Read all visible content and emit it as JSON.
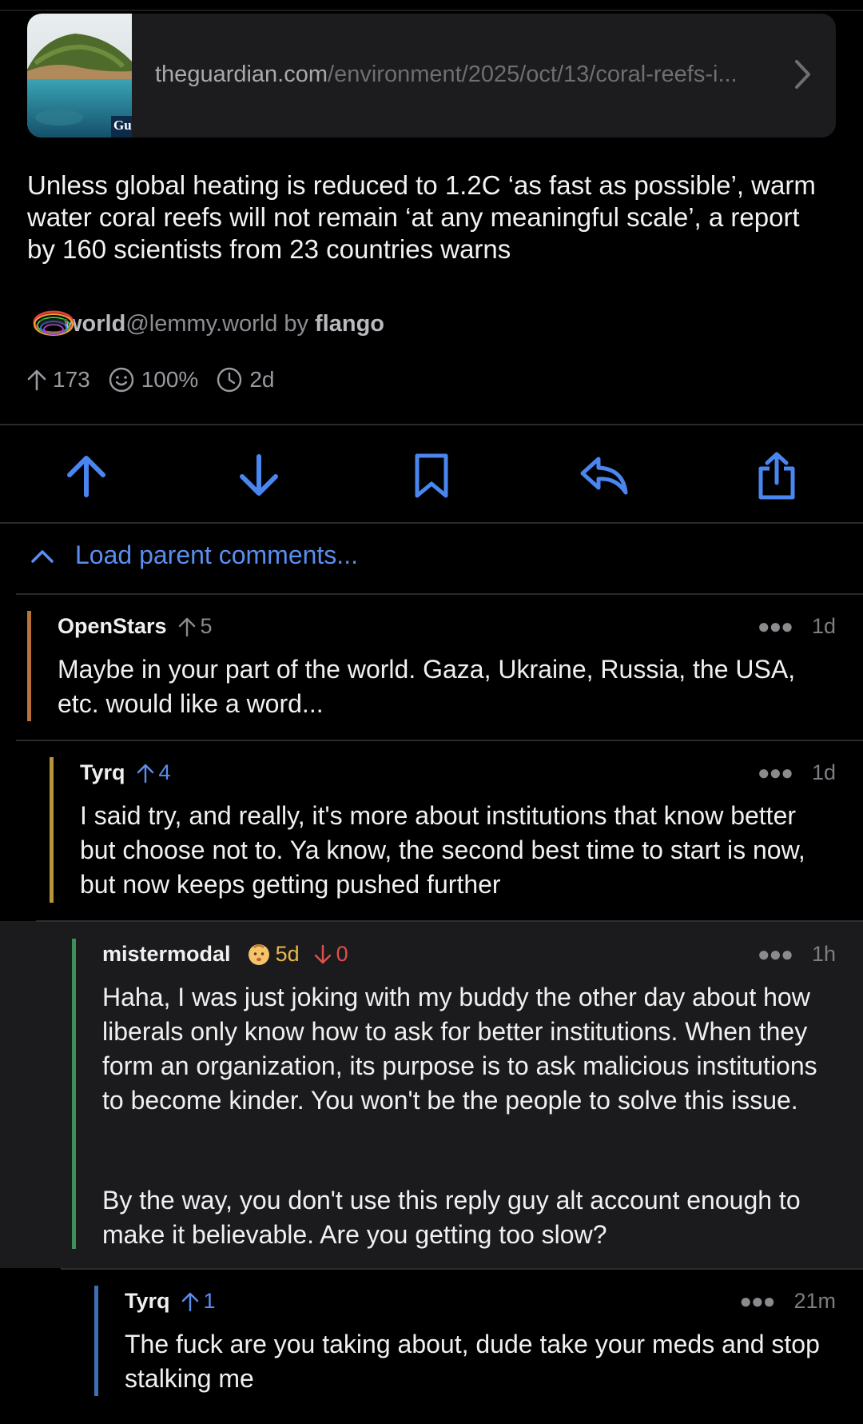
{
  "link": {
    "domain": "theguardian.com",
    "path": "/environment/2025/oct/13/coral-reefs-i...",
    "thumb_label": "Gu"
  },
  "post": {
    "title": "Unless global heating is reduced to 1.2C ‘as fast as possible’, warm water coral reefs will not remain ‘at any meaningful scale’, a report by 160 scientists from 23 countries warns",
    "community_name": "world",
    "community_instance": "@lemmy.world",
    "by_label": "by",
    "author": "flango",
    "score": "173",
    "upvote_ratio": "100%",
    "age": "2d"
  },
  "actions": [
    "upvote-icon",
    "downvote-icon",
    "bookmark-icon",
    "reply-icon",
    "share-icon"
  ],
  "load_parent": "Load parent comments...",
  "comments": [
    {
      "user": "OpenStars",
      "score": "5",
      "age": "1d",
      "body": "Maybe in your part of the world. Gaza, Ukraine, Russia, the USA, etc. would like a word...",
      "bar_color": "#b8733a"
    },
    {
      "user": "Tyrq",
      "score": "4",
      "age": "1d",
      "body": "I said try, and really, it's more about institutions that know better but choose not to. Ya know, the second best time to start is now, but now keeps getting pushed further",
      "bar_color": "#b8953d"
    },
    {
      "user": "mistermodal",
      "account_age": "5d",
      "downvotes": "0",
      "age": "1h",
      "body_p1": "Haha, I was just joking with my buddy the other day about how liberals only know how to ask for better institutions. When they form an organization, its purpose is to ask malicious institutions to become kinder. You won't be the people to solve this issue.",
      "body_p2": "By the way, you don't use this reply guy alt account enough to make it believable. Are you getting too slow?",
      "bar_color": "#3f8f5a"
    },
    {
      "user": "Tyrq",
      "score": "1",
      "age": "21m",
      "body": "The fuck are you taking about, dude take your meds and stop stalking me",
      "bar_color": "#3d6fb8"
    }
  ],
  "colors": {
    "accent": "#5a8ef0",
    "score_gray": "#8a8a8f",
    "baby_yellow": "#e8b84a",
    "downvote_red": "#e0504a"
  }
}
